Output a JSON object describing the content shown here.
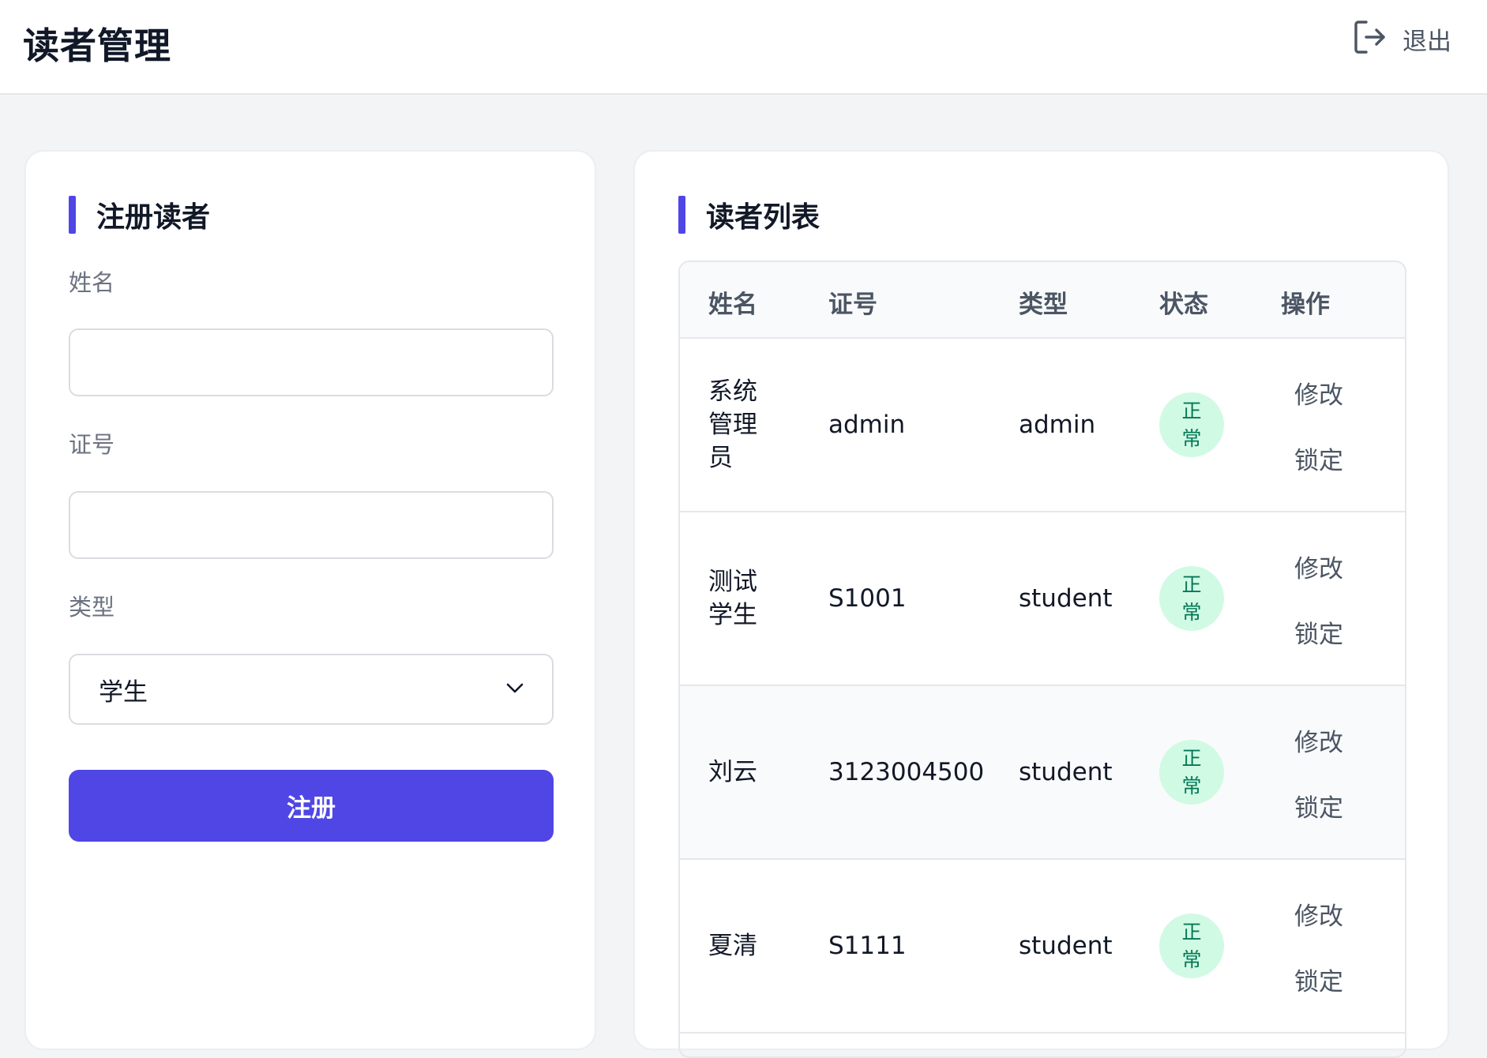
{
  "header": {
    "title": "读者管理",
    "logout_label": "退出"
  },
  "register": {
    "title": "注册读者",
    "name_label": "姓名",
    "name_value": "",
    "card_label": "证号",
    "card_value": "",
    "type_label": "类型",
    "type_selected": "学生",
    "submit_label": "注册"
  },
  "list": {
    "title": "读者列表",
    "columns": [
      "姓名",
      "证号",
      "类型",
      "状态",
      "操作"
    ],
    "rows": [
      {
        "name": "系统管理员",
        "card": "admin",
        "type": "admin",
        "status": "正常",
        "edit": "修改",
        "lock": "锁定"
      },
      {
        "name": "测试学生",
        "card": "S1001",
        "type": "student",
        "status": "正常",
        "edit": "修改",
        "lock": "锁定"
      },
      {
        "name": "刘云",
        "card": "3123004500",
        "type": "student",
        "status": "正常",
        "edit": "修改",
        "lock": "锁定"
      },
      {
        "name": "夏清",
        "card": "S1111",
        "type": "student",
        "status": "正常",
        "edit": "修改",
        "lock": "锁定"
      }
    ]
  },
  "colors": {
    "accent": "#4f46e5",
    "status_bg": "#d1fae5",
    "status_text": "#047857"
  },
  "icons": {
    "logout": "logout-icon",
    "select_arrow": "chevron-down-icon"
  }
}
